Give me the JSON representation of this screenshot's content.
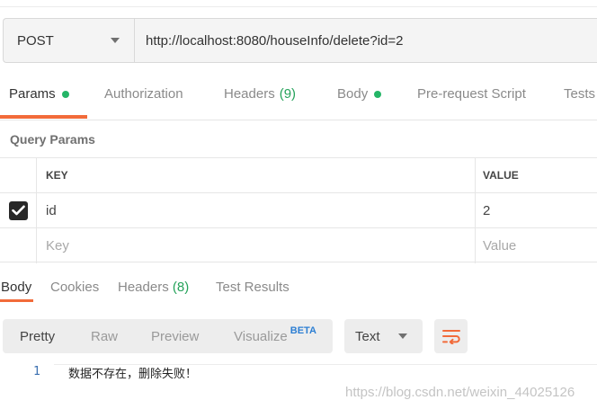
{
  "request": {
    "method": "POST",
    "url": "http://localhost:8080/houseInfo/delete?id=2"
  },
  "request_tabs": {
    "params": "Params",
    "authorization": "Authorization",
    "headers": "Headers",
    "headers_count": "(9)",
    "body": "Body",
    "pre_request": "Pre-request Script",
    "tests": "Tests"
  },
  "query_params": {
    "title": "Query Params",
    "col_key": "KEY",
    "col_value": "VALUE",
    "rows": [
      {
        "key": "id",
        "value": "2",
        "checked": true
      }
    ],
    "placeholder_key": "Key",
    "placeholder_value": "Value"
  },
  "response_tabs": {
    "body": "Body",
    "cookies": "Cookies",
    "headers": "Headers",
    "headers_count": "(8)",
    "test_results": "Test Results"
  },
  "response_toolbar": {
    "pretty": "Pretty",
    "raw": "Raw",
    "preview": "Preview",
    "visualize": "Visualize",
    "beta": "BETA",
    "format": "Text"
  },
  "response_body": {
    "line_number": "1",
    "content": "数据不存在，删除失败！"
  },
  "watermark": "https://blog.csdn.net/weixin_44025126",
  "colors": {
    "accent": "#f26b3a",
    "count_green": "#25a25a",
    "beta_blue": "#2d7fd3"
  }
}
